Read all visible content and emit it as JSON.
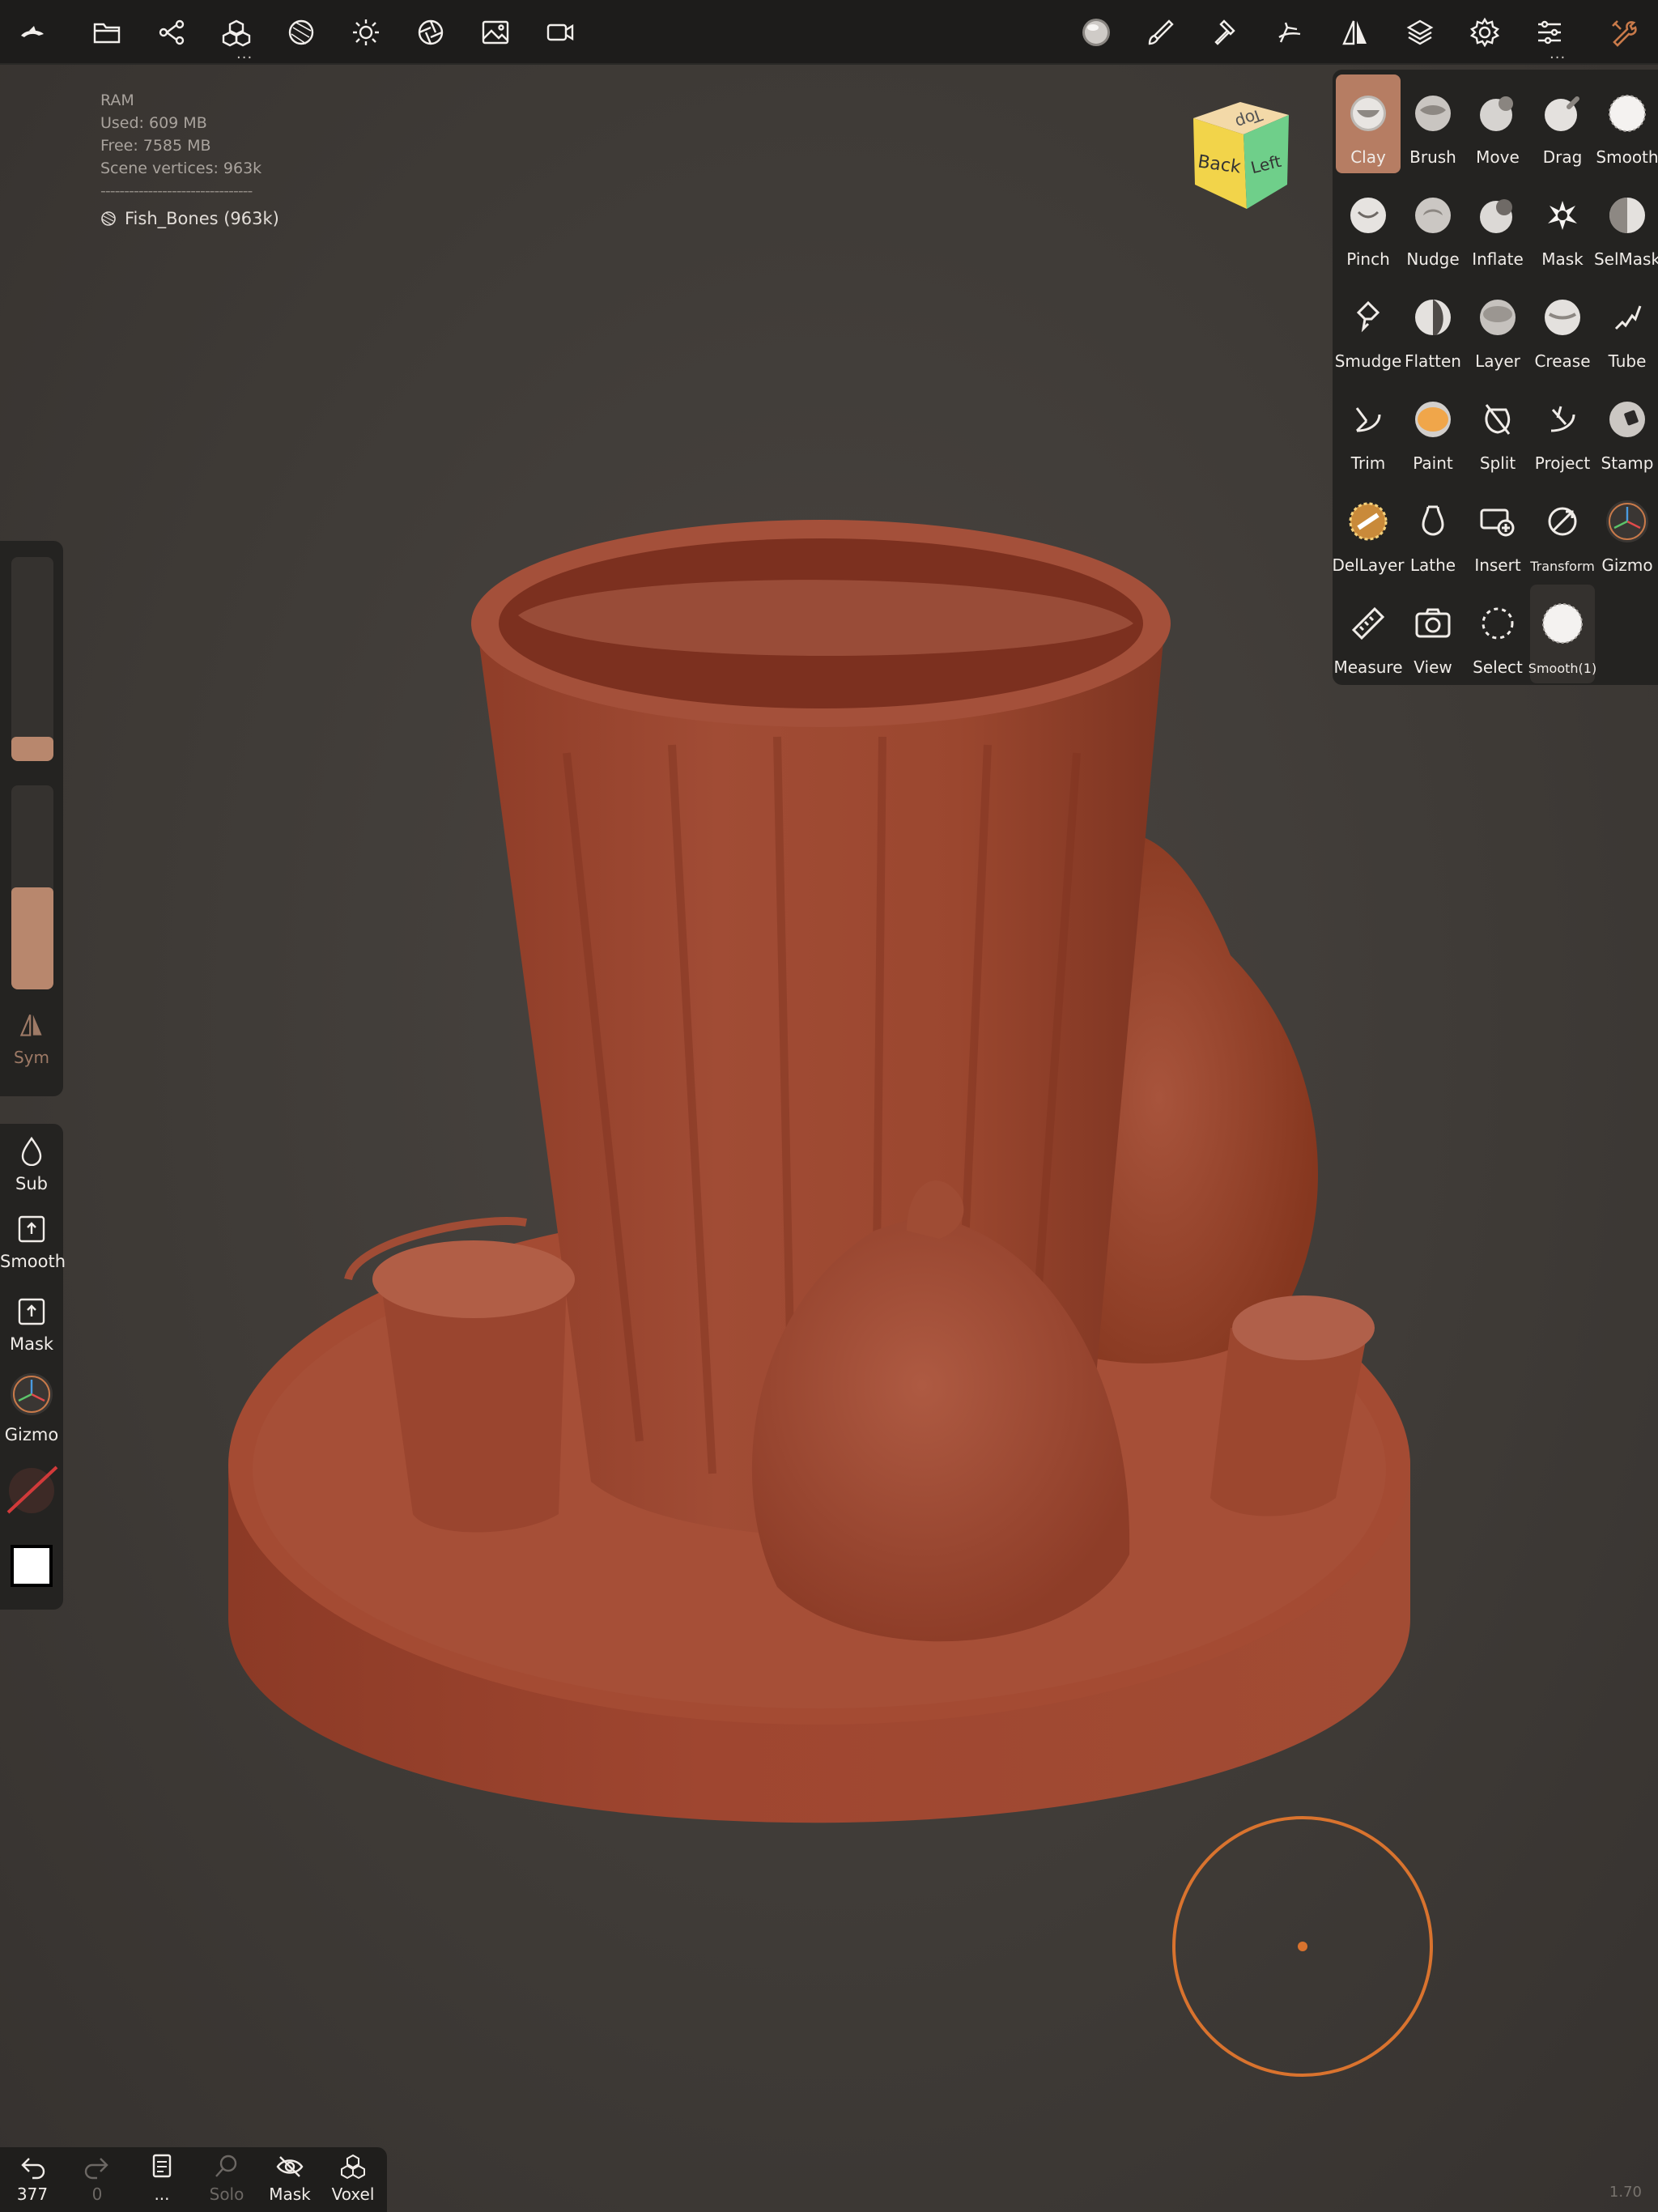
{
  "stats": {
    "ram_label": "RAM",
    "used": "Used: 609 MB",
    "free": "Free: 7585 MB",
    "vertices": "Scene vertices: 963k",
    "divider": "--------------------------------",
    "mesh_name": "Fish_Bones (963k)"
  },
  "view_cube": {
    "top": "Top",
    "back": "Back",
    "left": "Left"
  },
  "topbar": {
    "left_icons": [
      "app-logo-icon",
      "folder-icon",
      "scene-graph-icon",
      "primitives-icon",
      "material-sphere-icon",
      "light-icon",
      "shading-icon",
      "background-image-icon",
      "camera-video-icon"
    ],
    "right_icons": [
      "material-preview-icon",
      "paint-brush-icon",
      "hammer-icon",
      "hand-pose-icon",
      "symmetry-icon",
      "layers-icon",
      "settings-icon",
      "sliders-icon",
      "tools-wrench-icon"
    ],
    "dots": "..."
  },
  "tools": [
    {
      "label": "Clay",
      "active": true
    },
    {
      "label": "Brush"
    },
    {
      "label": "Move"
    },
    {
      "label": "Drag"
    },
    {
      "label": "Smooth"
    },
    {
      "label": "Pinch"
    },
    {
      "label": "Nudge"
    },
    {
      "label": "Inflate"
    },
    {
      "label": "Mask"
    },
    {
      "label": "SelMask"
    },
    {
      "label": "Smudge"
    },
    {
      "label": "Flatten"
    },
    {
      "label": "Layer"
    },
    {
      "label": "Crease"
    },
    {
      "label": "Tube"
    },
    {
      "label": "Trim"
    },
    {
      "label": "Paint"
    },
    {
      "label": "Split"
    },
    {
      "label": "Project"
    },
    {
      "label": "Stamp"
    },
    {
      "label": "DelLayer"
    },
    {
      "label": "Lathe"
    },
    {
      "label": "Insert"
    },
    {
      "label": "Transform"
    },
    {
      "label": "Gizmo"
    },
    {
      "label": "Measure"
    },
    {
      "label": "View"
    },
    {
      "label": "Select"
    },
    {
      "label": "Smooth(1)"
    }
  ],
  "left_panel": {
    "radius_fraction": 0.12,
    "intensity_fraction": 0.5,
    "sym_label": "Sym",
    "sub_label": "Sub",
    "smooth_label": "Smooth",
    "mask_label": "Mask",
    "gizmo_label": "Gizmo"
  },
  "bottom_bar": {
    "undo_count": "377",
    "redo_count": "0",
    "more_label": "...",
    "solo_label": "Solo",
    "mask_label": "Mask",
    "voxel_label": "Voxel"
  },
  "zoom_level": "1.70",
  "colors": {
    "accent": "#b67d63",
    "sculpt_clay": "#a24a32",
    "cursor_ring": "#d9732e",
    "panel_bg": "#242321"
  }
}
